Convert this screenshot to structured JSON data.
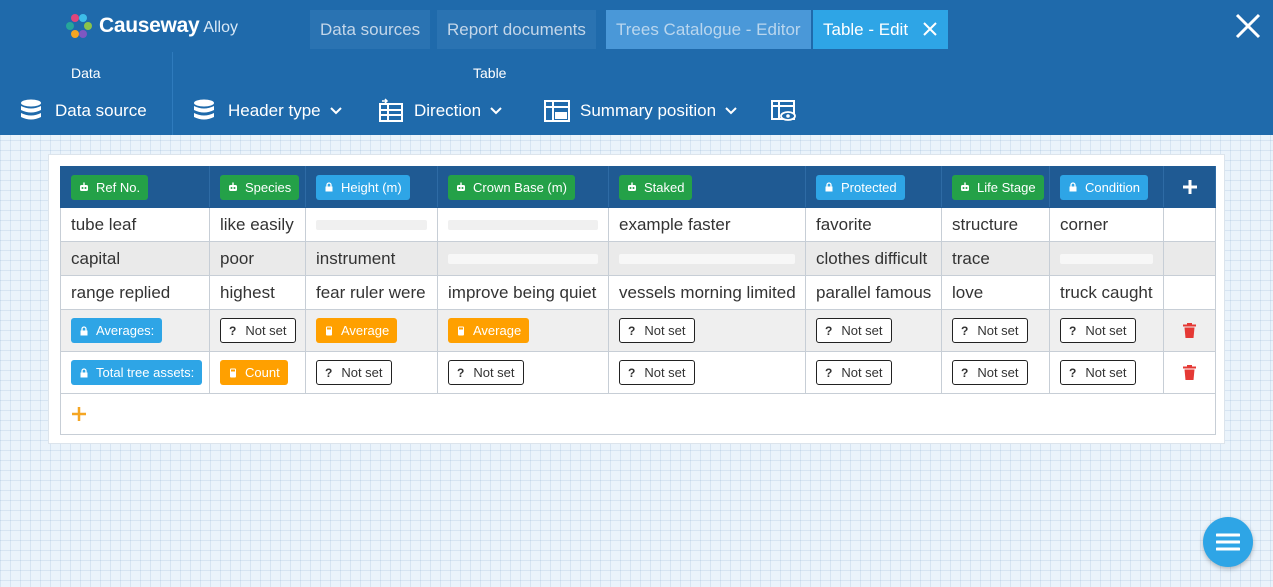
{
  "app": {
    "brand": "Causeway",
    "product": "Alloy"
  },
  "tabs": [
    {
      "label": "Data sources"
    },
    {
      "label": "Report documents"
    },
    {
      "label": "Trees Catalogue - Editor"
    },
    {
      "label": "Table - Edit"
    }
  ],
  "toolbar": {
    "data_section": "Data",
    "table_section": "Table",
    "data_source": "Data source",
    "header_type": "Header type",
    "direction": "Direction",
    "summary_position": "Summary position"
  },
  "columns": [
    {
      "label": "Ref No.",
      "color": "#24a148",
      "icon": "robot-icon"
    },
    {
      "label": "Species",
      "color": "#24a148",
      "icon": "robot-icon"
    },
    {
      "label": "Height (m)",
      "color": "#2ea5e6",
      "icon": "lock-icon"
    },
    {
      "label": "Crown Base (m)",
      "color": "#24a148",
      "icon": "robot-icon"
    },
    {
      "label": "Staked",
      "color": "#24a148",
      "icon": "robot-icon"
    },
    {
      "label": "Protected",
      "color": "#2ea5e6",
      "icon": "lock-icon"
    },
    {
      "label": "Life Stage",
      "color": "#24a148",
      "icon": "robot-icon"
    },
    {
      "label": "Condition",
      "color": "#2ea5e6",
      "icon": "lock-icon"
    }
  ],
  "rows": [
    [
      "tube leaf",
      "like easily",
      "",
      "",
      "example faster",
      "favorite",
      "structure",
      "corner"
    ],
    [
      "capital",
      "poor",
      "instrument",
      "",
      "",
      "clothes difficult",
      "trace",
      ""
    ],
    [
      "range replied",
      "highest",
      "fear ruler were",
      "improve being quiet",
      "vessels morning limited",
      "parallel famous",
      "love",
      "truck caught"
    ]
  ],
  "summaries": [
    {
      "label": "Averages:",
      "cells": [
        "Not set",
        "Average",
        "Average",
        "Not set",
        "Not set",
        "Not set",
        "Not set"
      ]
    },
    {
      "label": "Total tree assets:",
      "cells": [
        "Count",
        "Not set",
        "Not set",
        "Not set",
        "Not set",
        "Not set",
        "Not set"
      ]
    }
  ],
  "colors": {
    "topbar": "#1f6aab",
    "tab_active": "#2ea5e6",
    "header_row": "#1f5a93",
    "chip_green": "#24a148",
    "chip_blue": "#2ea5e6",
    "chip_orange": "#ffa000",
    "delete_red": "#e53935",
    "add_orange": "#f5a623"
  }
}
